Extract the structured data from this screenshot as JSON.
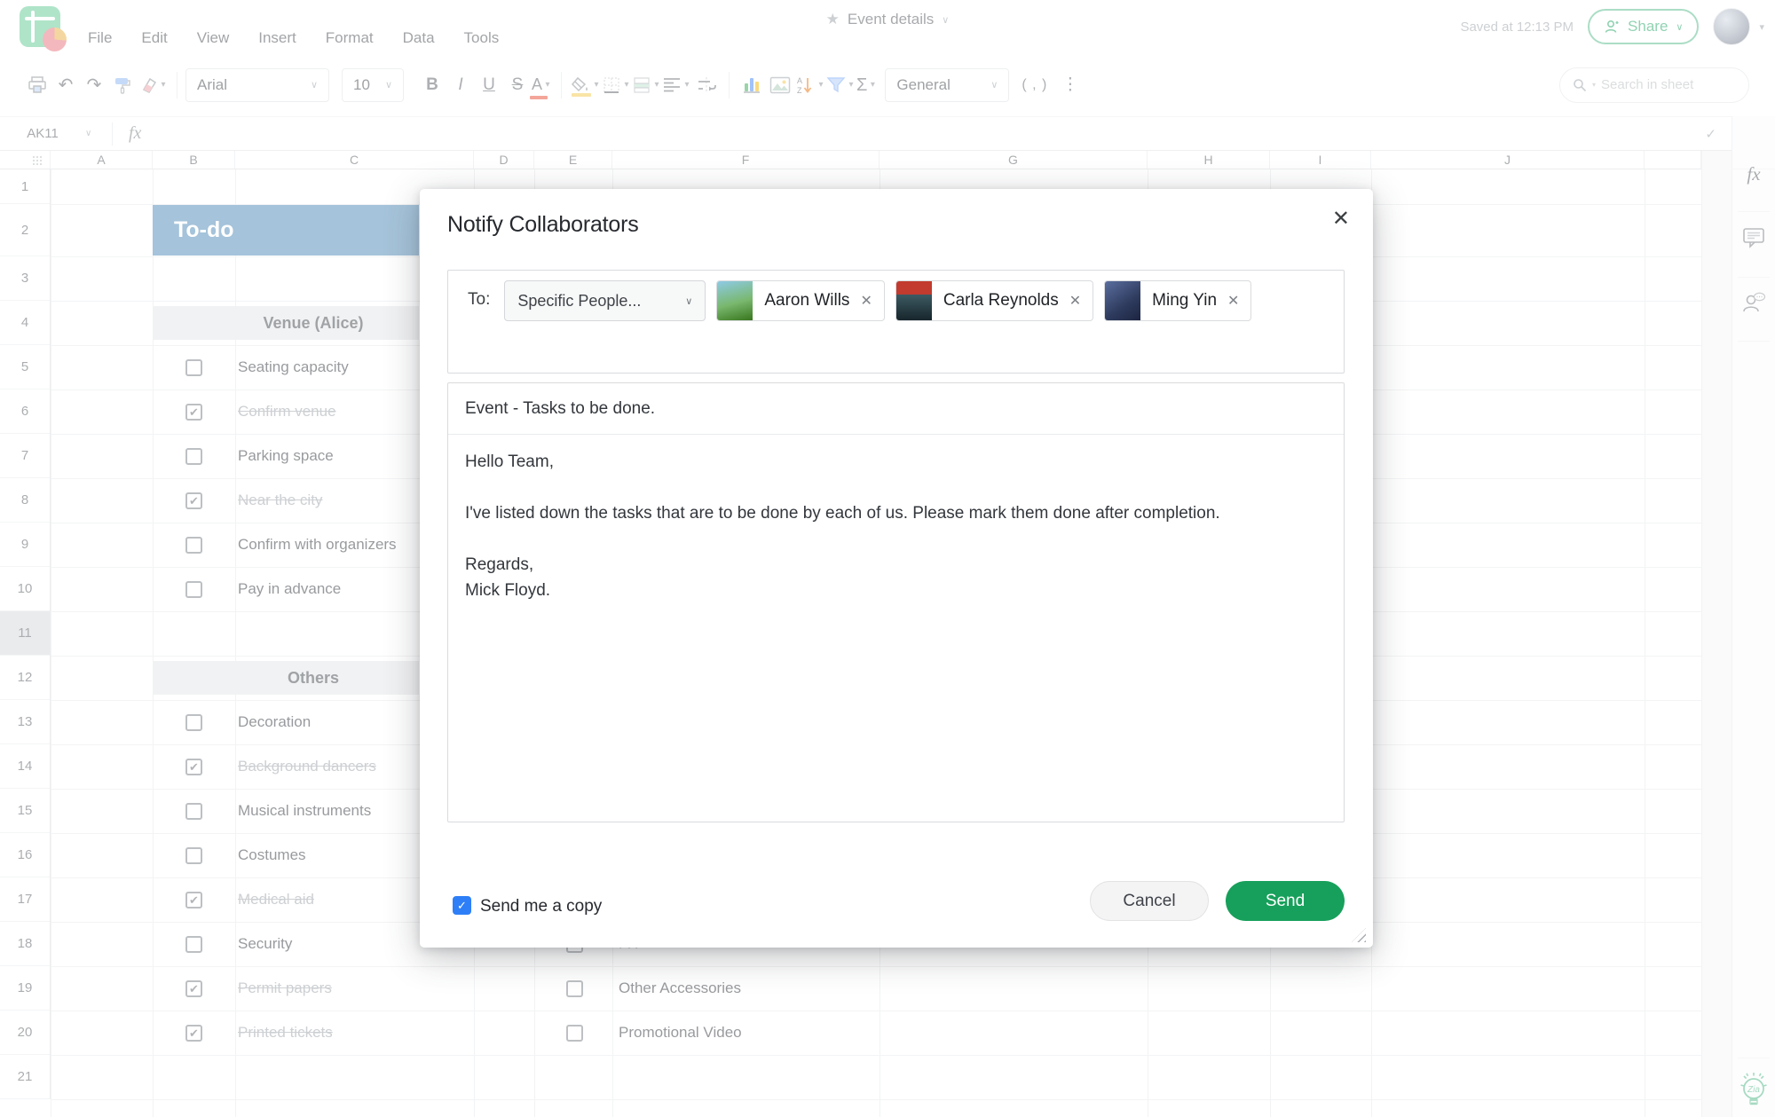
{
  "app": {
    "menu": [
      "File",
      "Edit",
      "View",
      "Insert",
      "Format",
      "Data",
      "Tools"
    ],
    "doc_title": "Event details",
    "saved_status": "Saved at 12:13 PM",
    "share_label": "Share"
  },
  "toolbar": {
    "font_name": "Arial",
    "font_size": "10",
    "bold": "B",
    "italic": "I",
    "underline": "U",
    "strikethrough": "S",
    "text_color": "A",
    "sum": "Σ",
    "comma_format": "( , )",
    "number_format": "General",
    "search_placeholder": "Search in sheet"
  },
  "formula_bar": {
    "cell_ref": "AK11",
    "fx": "fx"
  },
  "grid": {
    "columns": [
      "A",
      "B",
      "C",
      "D",
      "E",
      "F",
      "G",
      "H",
      "I",
      "J"
    ],
    "rows": [
      "1",
      "2",
      "3",
      "4",
      "5",
      "6",
      "7",
      "8",
      "9",
      "10",
      "11",
      "12",
      "13",
      "14",
      "15",
      "16",
      "17",
      "18",
      "19",
      "20",
      "21"
    ],
    "selected_row": "11"
  },
  "sheet": {
    "title": "To-do",
    "sections": [
      {
        "title": "Venue (Alice)",
        "items": [
          {
            "label": "Seating capacity",
            "checked": false
          },
          {
            "label": "Confirm venue",
            "checked": true
          },
          {
            "label": "Parking space",
            "checked": false
          },
          {
            "label": "Near the city",
            "checked": true
          },
          {
            "label": "Confirm with organizers",
            "checked": false
          },
          {
            "label": "Pay in advance",
            "checked": false
          }
        ]
      },
      {
        "title": "Others",
        "items": [
          {
            "label": "Decoration",
            "checked": false
          },
          {
            "label": "Background dancers",
            "checked": true
          },
          {
            "label": "Musical instruments",
            "checked": false
          },
          {
            "label": "Costumes",
            "checked": false
          },
          {
            "label": "Medical aid",
            "checked": true
          },
          {
            "label": "Security",
            "checked": false
          },
          {
            "label": "Permit papers",
            "checked": true
          },
          {
            "label": "Printed tickets",
            "checked": true
          }
        ]
      }
    ],
    "column2_items": [
      {
        "label": "FX",
        "checked": true
      },
      {
        "label": "Other Accessories",
        "checked": false
      },
      {
        "label": "Promotional Video",
        "checked": false
      }
    ]
  },
  "dialog": {
    "title": "Notify Collaborators",
    "to_label": "To:",
    "recipient_selector": "Specific People...",
    "recipients": [
      {
        "name": "Aaron Wills"
      },
      {
        "name": "Carla Reynolds"
      },
      {
        "name": "Ming Yin"
      }
    ],
    "subject": "Event - Tasks to be done.",
    "body": "Hello Team,\n\nI've listed down the tasks that are to be done by each of us. Please mark them done after completion.\n\nRegards,\nMick Floyd.",
    "send_copy_label": "Send me a copy",
    "send_copy_checked": true,
    "cancel_label": "Cancel",
    "send_label": "Send"
  },
  "colors": {
    "brand_green": "#21a463",
    "send_green": "#17a05b",
    "todo_band_blue": "#4a86b5",
    "copy_checkbox_blue": "#2e7ff7",
    "text_color_red": "#e94b35",
    "fill_yellow": "#f2c94c",
    "filter_blue": "#7baaf7"
  }
}
